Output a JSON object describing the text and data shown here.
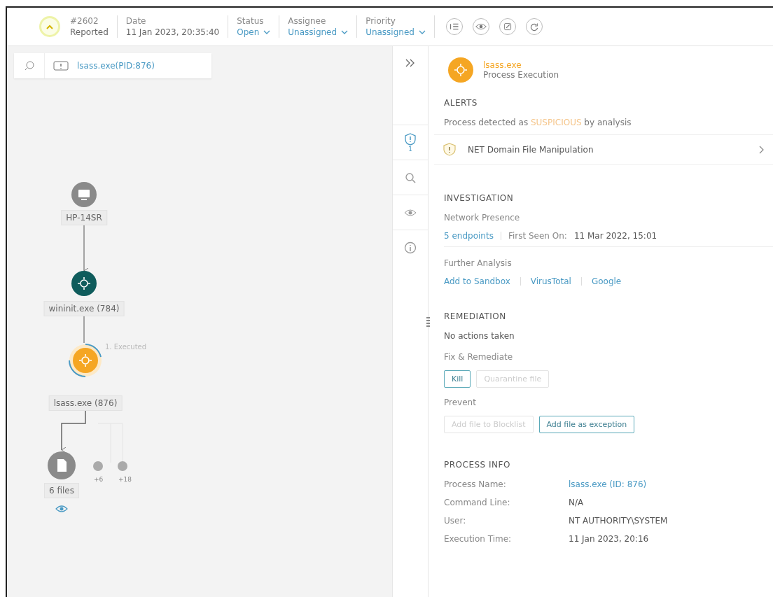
{
  "header": {
    "incident": {
      "number": "#2602",
      "state": "Reported"
    },
    "fields": [
      {
        "label": "Date",
        "value": "11 Jan 2023, 20:35:40",
        "dropdown": false
      },
      {
        "label": "Status",
        "value": "Open",
        "dropdown": true
      },
      {
        "label": "Assignee",
        "value": "Unassigned",
        "dropdown": true
      },
      {
        "label": "Priority",
        "value": "Unassigned",
        "dropdown": true
      }
    ]
  },
  "search": {
    "chip": "lsass.exe(PID:876)"
  },
  "graph": {
    "nodes": [
      {
        "kind": "host",
        "label": "HP-14SR"
      },
      {
        "kind": "process",
        "label": "wininit.exe (784)"
      },
      {
        "kind": "focus",
        "label": "lsass.exe (876)"
      }
    ],
    "edge_label": "1. Executed",
    "files": {
      "label": "6 files",
      "extra": [
        "+6",
        "+18"
      ]
    }
  },
  "rail": [
    {
      "kind": "alerts",
      "badge": "1",
      "selected": true
    },
    {
      "kind": "investigate",
      "selected": false
    },
    {
      "kind": "view",
      "selected": false
    },
    {
      "kind": "info",
      "selected": false
    }
  ],
  "panel": {
    "title": "lsass.exe",
    "subtitle": "Process Execution",
    "alerts": {
      "heading": "ALERTS",
      "summary": {
        "before": "Process detected as",
        "verdict": "SUSPICIOUS",
        "after": "by analysis"
      },
      "items": [
        "NET Domain File Manipulation"
      ]
    },
    "investigation": {
      "heading": "INVESTIGATION",
      "presence_label": "Network Presence",
      "endpoints": "5 endpoints",
      "first_seen_label": "First Seen On:",
      "first_seen": "11 Mar 2022, 15:01",
      "analysis_label": "Further Analysis",
      "links": [
        "Add to Sandbox",
        "VirusTotal",
        "Google"
      ]
    },
    "remediation": {
      "heading": "REMEDIATION",
      "status": "No actions taken",
      "groups": [
        {
          "label": "Fix & Remediate",
          "buttons": [
            {
              "label": "Kill",
              "disabled": false
            },
            {
              "label": "Quarantine file",
              "disabled": true
            }
          ]
        },
        {
          "label": "Prevent",
          "buttons": [
            {
              "label": "Add file to Blocklist",
              "disabled": true
            },
            {
              "label": "Add file as exception",
              "disabled": false
            }
          ]
        }
      ]
    },
    "process_info": {
      "heading": "PROCESS INFO",
      "rows": [
        {
          "label": "Process Name:",
          "value": "lsass.exe (ID: 876)",
          "link": true
        },
        {
          "label": "Command Line:",
          "value": "N/A",
          "link": false
        },
        {
          "label": "User:",
          "value": "NT AUTHORITY\\SYSTEM",
          "link": false
        },
        {
          "label": "Execution Time:",
          "value": "11 Jan 2023, 20:16",
          "link": false
        }
      ]
    }
  }
}
